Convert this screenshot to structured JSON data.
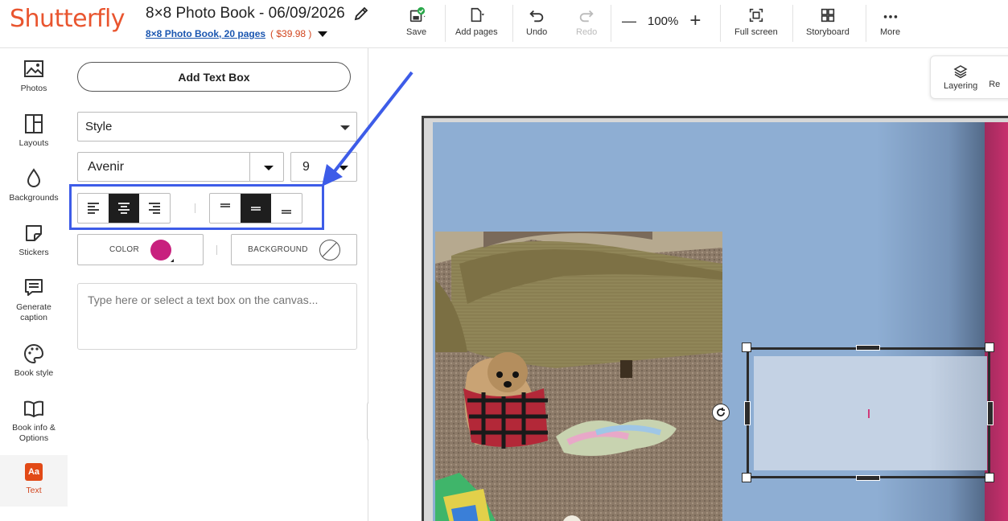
{
  "header": {
    "logo": "Shutterfly",
    "doc_title": "8×8 Photo Book - 06/09/2026",
    "doc_subtitle_link": "8×8 Photo Book, 20 pages",
    "doc_price": "( $39.98 )",
    "toolbar": {
      "save": "Save",
      "add_pages": "Add pages",
      "undo": "Undo",
      "redo": "Redo",
      "zoom_minus": "—",
      "zoom_value": "100%",
      "zoom_plus": "+",
      "full_screen": "Full screen",
      "storyboard": "Storyboard",
      "more": "More"
    }
  },
  "rail": {
    "photos": "Photos",
    "layouts": "Layouts",
    "backgrounds": "Backgrounds",
    "stickers": "Stickers",
    "generate_caption_1": "Generate",
    "generate_caption_2": "caption",
    "book_style": "Book style",
    "book_info_1": "Book info &",
    "book_info_2": "Options",
    "text_icon": "Aa",
    "text": "Text"
  },
  "panel": {
    "add_text_box": "Add Text Box",
    "style_select": "Style",
    "font_select": "Avenir",
    "size_select": "9",
    "color_label": "COLOR",
    "background_label": "BACKGROUND",
    "text_placeholder": "Type here or select a text box on the canvas...",
    "align_selected": "center",
    "valign_selected": "middle"
  },
  "canvas": {
    "layering": "Layering",
    "next_tool_partial": "Re"
  },
  "colors": {
    "brand": "#e9552f",
    "text_color": "#c8207e",
    "annotation": "#3d5ce8",
    "page_background": "#8eaed3"
  }
}
